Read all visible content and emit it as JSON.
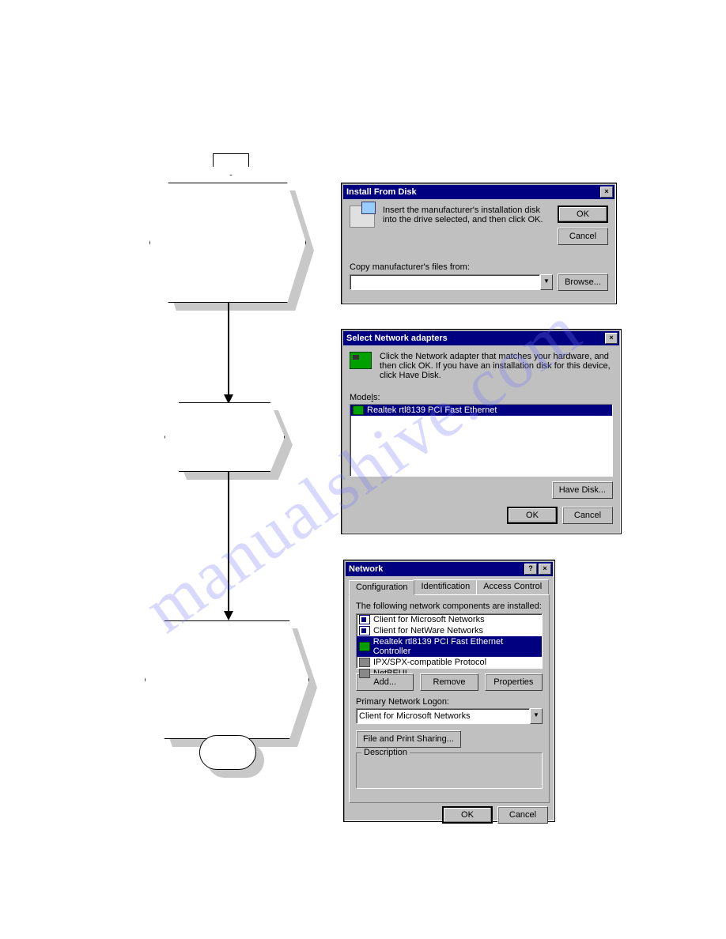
{
  "watermark": "manualshive.com",
  "flowchart": {
    "nodes": [
      "",
      "",
      ""
    ]
  },
  "dlg1": {
    "title": "Install From Disk",
    "instruction": "Insert the manufacturer's installation disk into the drive selected, and then click OK.",
    "copy_label": "Copy manufacturer's files from:",
    "input_value": "",
    "ok": "OK",
    "cancel": "Cancel",
    "browse": "Browse..."
  },
  "dlg2": {
    "title": "Select Network adapters",
    "instruction": "Click the Network adapter that matches your hardware, and then click OK. If you have an installation disk for this device, click Have Disk.",
    "models_label": "Models:",
    "model_item": "Realtek rtl8139 PCI Fast Ethernet",
    "have_disk": "Have Disk...",
    "ok": "OK",
    "cancel": "Cancel"
  },
  "dlg3": {
    "title": "Network",
    "tabs": [
      "Configuration",
      "Identification",
      "Access Control"
    ],
    "components_label": "The following network components are installed:",
    "items": [
      "Client for Microsoft Networks",
      "Client for NetWare Networks",
      "Realtek rtl8139 PCI Fast Ethernet Controller",
      "IPX/SPX-compatible Protocol",
      "NetBEUI"
    ],
    "add": "Add...",
    "remove": "Remove",
    "properties": "Properties",
    "logon_label": "Primary Network Logon:",
    "logon_value": "Client for Microsoft Networks",
    "file_sharing": "File and Print Sharing...",
    "description_label": "Description",
    "ok": "OK",
    "cancel": "Cancel"
  }
}
